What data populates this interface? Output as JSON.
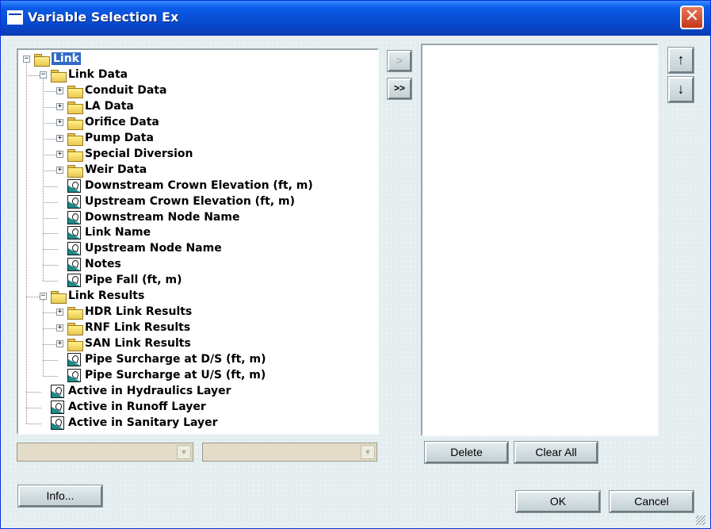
{
  "window": {
    "title": "Variable Selection Ex",
    "close_glyph": "✕"
  },
  "tree": {
    "nodes": [
      {
        "label": "Link",
        "kind": "folder-open",
        "expander": "−",
        "selected": true
      },
      {
        "label": "Link Data",
        "kind": "folder-open",
        "expander": "−"
      },
      {
        "label": "Conduit Data",
        "kind": "folder",
        "expander": "+"
      },
      {
        "label": "LA Data",
        "kind": "folder",
        "expander": "+"
      },
      {
        "label": "Orifice Data",
        "kind": "folder",
        "expander": "+"
      },
      {
        "label": "Pump Data",
        "kind": "folder",
        "expander": "+"
      },
      {
        "label": "Special Diversion",
        "kind": "folder",
        "expander": "+"
      },
      {
        "label": "Weir Data",
        "kind": "folder",
        "expander": "+"
      },
      {
        "label": "Downstream Crown Elevation (ft, m)",
        "kind": "variable"
      },
      {
        "label": "Upstream Crown Elevation (ft, m)",
        "kind": "variable"
      },
      {
        "label": "Downstream Node Name",
        "kind": "variable"
      },
      {
        "label": "Link Name",
        "kind": "variable"
      },
      {
        "label": "Upstream Node Name",
        "kind": "variable"
      },
      {
        "label": "Notes",
        "kind": "variable"
      },
      {
        "label": "Pipe Fall (ft, m)",
        "kind": "variable"
      },
      {
        "label": "Link Results",
        "kind": "folder-open",
        "expander": "−"
      },
      {
        "label": "HDR Link Results",
        "kind": "folder",
        "expander": "+"
      },
      {
        "label": "RNF Link Results",
        "kind": "folder",
        "expander": "+"
      },
      {
        "label": "SAN Link Results",
        "kind": "folder",
        "expander": "+"
      },
      {
        "label": "Pipe Surcharge at D/S (ft, m)",
        "kind": "variable"
      },
      {
        "label": "Pipe Surcharge at U/S (ft, m)",
        "kind": "variable"
      },
      {
        "label": "Active in Hydraulics Layer",
        "kind": "variable"
      },
      {
        "label": "Active in Runoff  Layer",
        "kind": "variable"
      },
      {
        "label": "Active in Sanitary  Layer",
        "kind": "variable"
      }
    ]
  },
  "combos": {
    "left": {
      "value": ""
    },
    "right": {
      "value": ""
    }
  },
  "transfer": {
    "add_one": ">",
    "add_all": ">>"
  },
  "move": {
    "up": "↑",
    "down": "↓"
  },
  "buttons": {
    "delete": "Delete",
    "clear_all": "Clear All",
    "info": "Info...",
    "ok": "OK",
    "cancel": "Cancel"
  },
  "selected_list": []
}
